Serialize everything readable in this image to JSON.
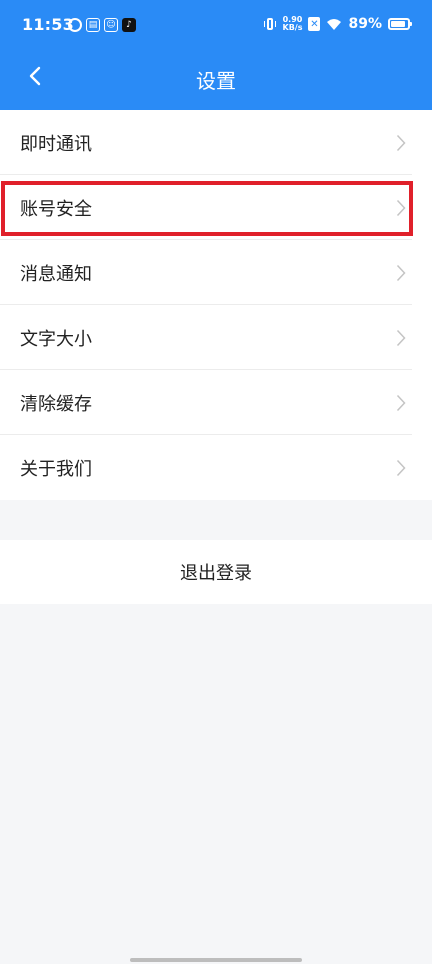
{
  "status_bar": {
    "time": "11:53",
    "net_speed_value": "0.90",
    "net_speed_unit": "KB/s",
    "battery_pct": "89%",
    "battery_level": 0.89
  },
  "header": {
    "title": "设置"
  },
  "settings": {
    "items": [
      {
        "label": "即时通讯"
      },
      {
        "label": "账号安全"
      },
      {
        "label": "消息通知"
      },
      {
        "label": "文字大小"
      },
      {
        "label": "清除缓存"
      },
      {
        "label": "关于我们"
      }
    ]
  },
  "logout": {
    "label": "退出登录"
  },
  "colors": {
    "header_bg": "#2a8bf6",
    "highlight": "#e0202a",
    "page_bg": "#f5f6f8"
  }
}
